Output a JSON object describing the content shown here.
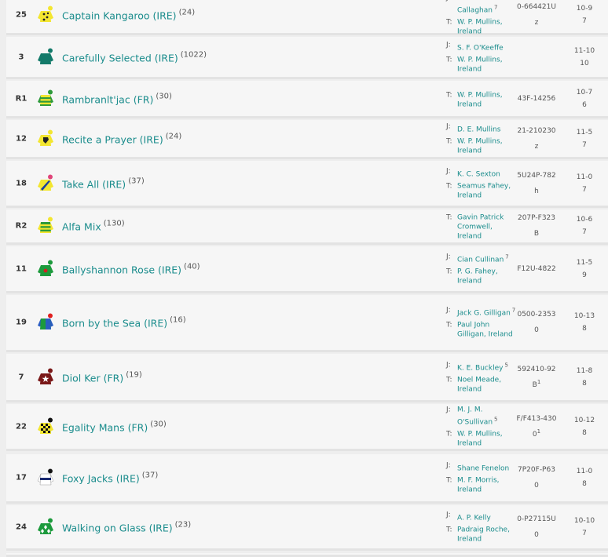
{
  "runners": [
    {
      "num": "25",
      "name": "Captain Kangaroo (IRE)",
      "rating": "(24)",
      "jockey": "Nicholas Callaghan",
      "claim": "7",
      "trainer": "W. P. Mullins, Ireland",
      "form": "0-664421U",
      "equip": "z",
      "equip_sup": "",
      "weight": "10-9",
      "or": "7",
      "silk": {
        "body": "#f3e630",
        "sleeve": "#f3e630",
        "cap": "#f3e630",
        "pattern": "spots",
        "pcolor": "#222"
      }
    },
    {
      "num": "3",
      "name": "Carefully Selected (IRE)",
      "rating": "(1022)",
      "jockey": "S. F. O'Keeffe",
      "claim": "",
      "trainer": "W. P. Mullins, Ireland",
      "form": "",
      "equip": "",
      "equip_sup": "",
      "weight": "11-10",
      "or": "10",
      "silk": {
        "body": "#137a6a",
        "sleeve": "#137a6a",
        "cap": "#137a6a",
        "pattern": "none",
        "pcolor": ""
      }
    },
    {
      "num": "R1",
      "name": "Rambranlt'jac (FR)",
      "rating": "(30)",
      "jockey": "",
      "claim": "",
      "trainer": "W. P. Mullins, Ireland",
      "form": "43F-14256",
      "equip": "",
      "equip_sup": "",
      "weight": "10-7",
      "or": "6",
      "silk": {
        "body": "#f3e630",
        "sleeve": "#2e9a3a",
        "cap": "#2e9a3a",
        "pattern": "hoops",
        "pcolor": "#2e9a3a"
      }
    },
    {
      "num": "12",
      "name": "Recite a Prayer (IRE)",
      "rating": "(24)",
      "jockey": "D. E. Mullins",
      "claim": "",
      "trainer": "W. P. Mullins, Ireland",
      "form": "21-210230",
      "equip": "z",
      "equip_sup": "",
      "weight": "11-5",
      "or": "7",
      "silk": {
        "body": "#f3e630",
        "sleeve": "#f3e630",
        "cap": "#f3e630",
        "pattern": "horse",
        "pcolor": "#222"
      }
    },
    {
      "num": "18",
      "name": "Take All (IRE)",
      "rating": "(37)",
      "jockey": "K. C. Sexton",
      "claim": "",
      "trainer": "Seamus Fahey, Ireland",
      "form": "5U24P-782",
      "equip": "h",
      "equip_sup": "",
      "weight": "11-0",
      "or": "7",
      "silk": {
        "body": "#f3e630",
        "sleeve": "#f3e630",
        "cap": "#e0457a",
        "pattern": "sash",
        "pcolor": "#1a3ea0"
      }
    },
    {
      "num": "R2",
      "name": "Alfa Mix",
      "rating": "(130)",
      "jockey": "",
      "claim": "",
      "trainer": "Gavin Patrick Cromwell, Ireland",
      "form": "207P-F323",
      "equip": "B",
      "equip_sup": "",
      "weight": "10-6",
      "or": "7",
      "silk": {
        "body": "#2e9a3a",
        "sleeve": "#f3e630",
        "cap": "#f3e630",
        "pattern": "hoops",
        "pcolor": "#f3e630"
      }
    },
    {
      "num": "11",
      "name": "Ballyshannon Rose (IRE)",
      "rating": "(40)",
      "jockey": "Cian Cullinan",
      "claim": "7",
      "trainer": "P. G. Fahey, Ireland",
      "form": "F12U-4822",
      "equip": "",
      "equip_sup": "",
      "weight": "11-5",
      "or": "9",
      "silk": {
        "body": "#1c9a3c",
        "sleeve": "#1c9a3c",
        "cap": "#1c9a3c",
        "pattern": "dot",
        "pcolor": "#d12020"
      }
    },
    {
      "num": "19",
      "name": "Born by the Sea (IRE)",
      "rating": "(16)",
      "jockey": "Jack G. Gilligan",
      "claim": "7",
      "trainer": "Paul John Gilligan, Ireland",
      "form": "0500-2353",
      "equip": "0",
      "equip_sup": "",
      "weight": "10-13",
      "or": "8",
      "silk": {
        "body": "#1c9a3c",
        "sleeve": "#2a5dc0",
        "cap": "#e02020",
        "pattern": "halves",
        "pcolor": "#2a5dc0"
      }
    },
    {
      "num": "7",
      "name": "Diol Ker (FR)",
      "rating": "(19)",
      "jockey": "K. E. Buckley",
      "claim": "5",
      "trainer": "Noel Meade, Ireland",
      "form": "592410-92",
      "equip": "B",
      "equip_sup": "1",
      "weight": "11-8",
      "or": "8",
      "silk": {
        "body": "#7a1818",
        "sleeve": "#7a1818",
        "cap": "#7a1818",
        "pattern": "star",
        "pcolor": "#ffffff"
      }
    },
    {
      "num": "22",
      "name": "Egality Mans (FR)",
      "rating": "(30)",
      "jockey": "M. J. M. O'Sullivan",
      "claim": "5",
      "trainer": "W. P. Mullins, Ireland",
      "form": "F/F413-430",
      "equip": "0",
      "equip_sup": "1",
      "weight": "10-12",
      "or": "8",
      "silk": {
        "body": "#f3e630",
        "sleeve": "#f3e630",
        "cap": "#111111",
        "pattern": "check",
        "pcolor": "#111111"
      }
    },
    {
      "num": "17",
      "name": "Foxy Jacks (IRE)",
      "rating": "(37)",
      "jockey": "Shane Fenelon",
      "claim": "",
      "trainer": "M. F. Morris, Ireland",
      "form": "7P20F-P63",
      "equip": "0",
      "equip_sup": "",
      "weight": "11-0",
      "or": "8",
      "silk": {
        "body": "#ffffff",
        "sleeve": "#ffffff",
        "cap": "#111111",
        "pattern": "band",
        "pcolor": "#1a2a70"
      }
    },
    {
      "num": "24",
      "name": "Walking on Glass (IRE)",
      "rating": "(23)",
      "jockey": "A. P. Kelly",
      "claim": "",
      "trainer": "Padraig Roche, Ireland",
      "form": "0-P27115U",
      "equip": "0",
      "equip_sup": "",
      "weight": "10-10",
      "or": "7",
      "silk": {
        "body": "#1c9a3c",
        "sleeve": "#1c9a3c",
        "cap": "#1c9a3c",
        "pattern": "diamonds",
        "pcolor": "#ffffff"
      }
    }
  ],
  "labels": {
    "jockey": "J:",
    "trainer": "T:"
  }
}
